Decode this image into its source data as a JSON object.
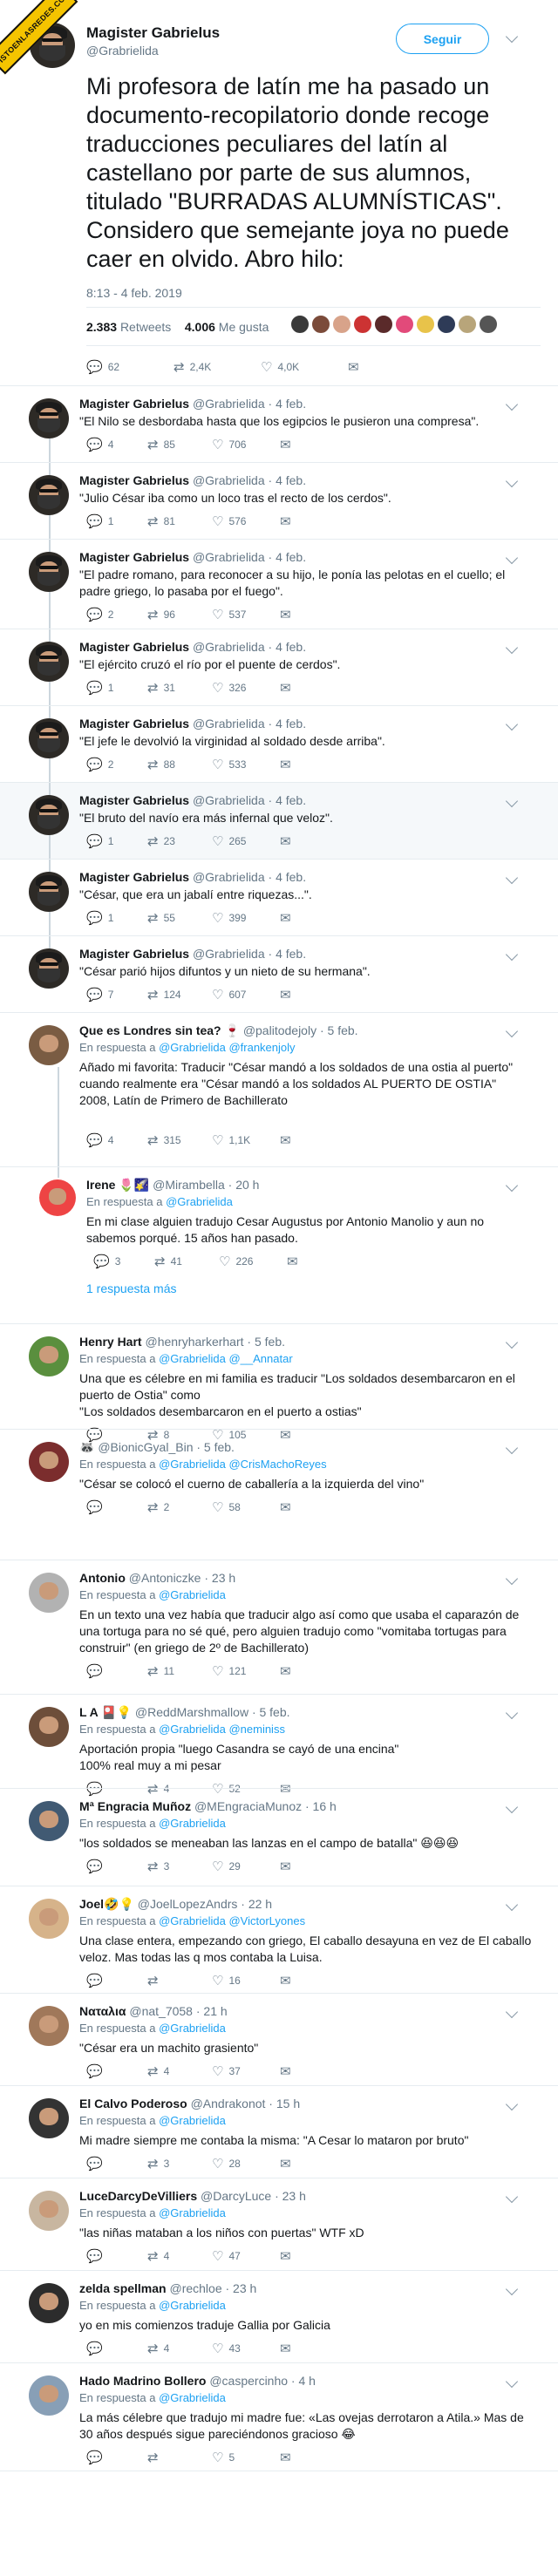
{
  "badge": "VISTOENLASREDES.COM",
  "main": {
    "name": "Magister Gabrielus",
    "handle": "@Grabrielida",
    "follow": "Seguir",
    "text": "Mi profesora de latín me ha pasado un documento-recopilatorio donde recoge traducciones peculiares del latín al castellano por parte de sus alumnos, titulado \"BURRADAS ALUMNÍSTICAS\". Considero que semejante joya no puede caer en olvido. Abro hilo:",
    "date": "8:13 - 4 feb. 2019",
    "retweets_num": "2.383",
    "retweets_label": "Retweets",
    "likes_num": "4.006",
    "likes_label": "Me gusta",
    "replies": "62",
    "rts": "2,4K",
    "favs": "4,0K",
    "liker_colors": [
      "#3a3a3a",
      "#7b4b3a",
      "#d8a38a",
      "#c33",
      "#5a2a2a",
      "#e24a7a",
      "#e8c34a",
      "#2e3b57",
      "#b8a57a",
      "#555"
    ]
  },
  "thread": [
    {
      "name": "Magister Gabrielus",
      "handle": "@Grabrielida · 4 feb.",
      "text": "\"El Nilo se desbordaba hasta que los egipcios le pusieron una compresa\".",
      "r": "4",
      "rt": "85",
      "l": "706"
    },
    {
      "name": "Magister Gabrielus",
      "handle": "@Grabrielida · 4 feb.",
      "text": "\"Julio César iba como un loco tras el recto de los cerdos\".",
      "r": "1",
      "rt": "81",
      "l": "576"
    },
    {
      "name": "Magister Gabrielus",
      "handle": "@Grabrielida · 4 feb.",
      "text": "\"El padre romano, para reconocer a su hijo, le ponía las pelotas en el cuello; el padre griego, lo pasaba por el fuego\".",
      "r": "2",
      "rt": "96",
      "l": "537"
    },
    {
      "name": "Magister Gabrielus",
      "handle": "@Grabrielida · 4 feb.",
      "text": "\"El ejército cruzó el río por el puente de cerdos\".",
      "r": "1",
      "rt": "31",
      "l": "326"
    },
    {
      "name": "Magister Gabrielus",
      "handle": "@Grabrielida · 4 feb.",
      "text": "\"El jefe le devolvió la virginidad al soldado desde arriba\".",
      "r": "2",
      "rt": "88",
      "l": "533"
    },
    {
      "name": "Magister Gabrielus",
      "handle": "@Grabrielida · 4 feb.",
      "text": "\"El bruto del navío era más infernal que veloz\".",
      "r": "1",
      "rt": "23",
      "l": "265"
    },
    {
      "name": "Magister Gabrielus",
      "handle": "@Grabrielida · 4 feb.",
      "text": "\"César, que era un jabalí entre riquezas...\".",
      "r": "1",
      "rt": "55",
      "l": "399"
    },
    {
      "name": "Magister Gabrielus",
      "handle": "@Grabrielida · 4 feb.",
      "text": "\"César parió hijos difuntos y un nieto de su hermana\".",
      "r": "7",
      "rt": "124",
      "l": "607"
    }
  ],
  "replies": [
    {
      "name": "Que es Londres sin tea? 🍷",
      "handle": "@palitodejoly · 5 feb.",
      "reply_prefix": "En respuesta a ",
      "reply_to": "@Grabrielida @frankenjoly",
      "text": "Añado mi favorita: Traducir \"César mandó a los soldados de una ostia al puerto\" cuando realmente era \"César mandó a los soldados AL PUERTO DE OSTIA\"\n2008, Latín de Primero de Bachillerato",
      "r": "4",
      "rt": "315",
      "l": "1,1K"
    },
    {
      "name": "Irene 🌷🌠",
      "handle": "@Mirambella · 20 h",
      "reply_prefix": "En respuesta a ",
      "reply_to": "@Grabrielida",
      "text": "En mi clase alguien tradujo Cesar Augustus por Antonio Manolio y aun no sabemos porqué. 15 años han pasado.",
      "r": "3",
      "rt": "41",
      "l": "226",
      "more": "1 respuesta más"
    },
    {
      "name": "Henry Hart",
      "handle": "@henryharkerhart · 5 feb.",
      "reply_prefix": "En respuesta a ",
      "reply_to": "@Grabrielida @__Annatar",
      "text": "Una que es célebre en mi familia es  traducir \"Los soldados desembarcaron en el puerto de Ostia\" como\n\"Los soldados desembarcaron en el puerto a ostias\"",
      "r": "",
      "rt": "8",
      "l": "105"
    },
    {
      "name": "🦝",
      "handle": "@BionicGyal_Bin · 5 feb.",
      "reply_prefix": "En respuesta a ",
      "reply_to": "@Grabrielida @CrisMachoReyes",
      "text": "\"César se colocó el cuerno de caballería a la izquierda del vino\"",
      "r": "",
      "rt": "2",
      "l": "58"
    },
    {
      "name": "Antonio",
      "handle": "@Antoniczke · 23 h",
      "reply_prefix": "En respuesta a ",
      "reply_to": "@Grabrielida",
      "text": "En un texto una vez había que traducir algo así como que usaba el caparazón de una tortuga para no sé qué, pero alguien tradujo como \"vomitaba tortugas para construir\" (en griego de 2º de Bachillerato)",
      "r": "",
      "rt": "11",
      "l": "121"
    },
    {
      "name": "L A 🎴💡",
      "handle": "@ReddMarshmallow · 5 feb.",
      "reply_prefix": "En respuesta a ",
      "reply_to": "@Grabrielida @neminiss",
      "text": "Aportación propia \"luego Casandra se cayó de una encina\"\n100% real muy a mi pesar",
      "r": "",
      "rt": "4",
      "l": "52"
    },
    {
      "name": "Mª Engracia Muñoz",
      "handle": "@MEngraciaMunoz · 16 h",
      "reply_prefix": "En respuesta a ",
      "reply_to": "@Grabrielida",
      "text": "\"los soldados se meneaban las lanzas en el campo de batalla\" 😆😆😆",
      "r": "",
      "rt": "3",
      "l": "29"
    },
    {
      "name": "Joel🤣💡",
      "handle": "@JoelLopezAndrs · 22 h",
      "reply_prefix": "En respuesta a ",
      "reply_to": "@Grabrielida @VictorLyones",
      "text": "Una clase entera, empezando con griego, El caballo desayuna en vez de El caballo veloz. Mas todas las q mos contaba la Luisa.",
      "r": "",
      "rt": "",
      "l": "16"
    },
    {
      "name": "Ναταλια",
      "handle": "@nat_7058 · 21 h",
      "reply_prefix": "En respuesta a ",
      "reply_to": "@Grabrielida",
      "text": "\"César era un machito grasiento\"",
      "r": "",
      "rt": "4",
      "l": "37"
    },
    {
      "name": "El Calvo Poderoso",
      "handle": "@Andrakonot · 15 h",
      "reply_prefix": "En respuesta a ",
      "reply_to": "@Grabrielida",
      "text": "Mi madre siempre me contaba la misma: \"A Cesar lo mataron por bruto\"",
      "r": "",
      "rt": "3",
      "l": "28"
    },
    {
      "name": "LuceDarcyDeVilliers",
      "handle": "@DarcyLuce · 23 h",
      "reply_prefix": "En respuesta a ",
      "reply_to": "@Grabrielida",
      "text": "\"las niñas mataban a los niños con puertas\" WTF xD",
      "r": "",
      "rt": "4",
      "l": "47"
    },
    {
      "name": "zelda spellman",
      "handle": "@rechloe · 23 h",
      "reply_prefix": "En respuesta a ",
      "reply_to": "@Grabrielida",
      "text": "yo en mis comienzos traduje Gallia por Galicia",
      "r": "",
      "rt": "4",
      "l": "43"
    },
    {
      "name": "Hado Madrino Bollero",
      "handle": "@caspercinho · 4 h",
      "reply_prefix": "En respuesta a ",
      "reply_to": "@Grabrielida",
      "text": "La más célebre que tradujo mi madre fue: «Las ovejas derrotaron a Atila.» Mas de 30 años después sigue pareciéndonos gracioso 😂",
      "r": "",
      "rt": "",
      "l": "5"
    }
  ]
}
